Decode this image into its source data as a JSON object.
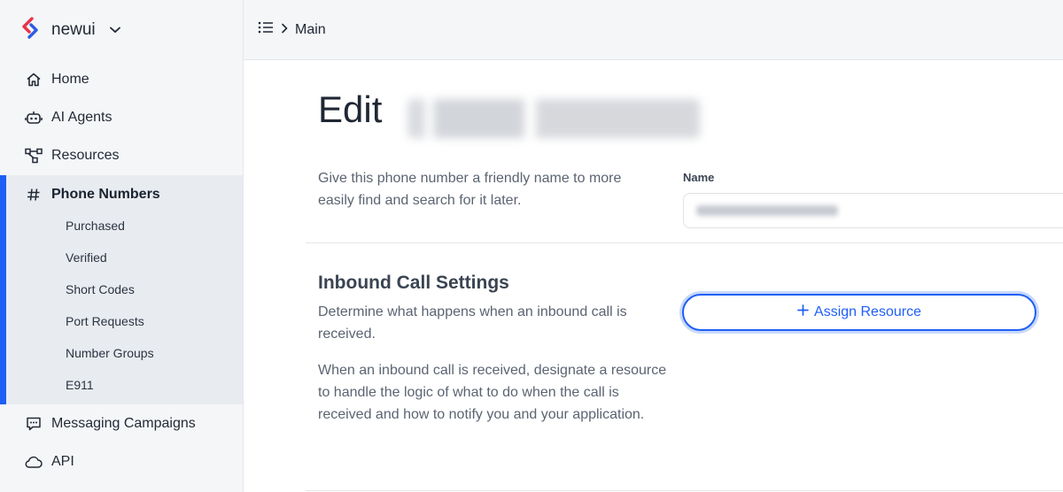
{
  "brand": {
    "name": "newui",
    "logo_icon": "brand-logo-icon",
    "caret_icon": "chevron-down-icon"
  },
  "sidebar": {
    "items": [
      {
        "label": "Home",
        "icon": "home-icon"
      },
      {
        "label": "AI Agents",
        "icon": "robot-icon"
      },
      {
        "label": "Resources",
        "icon": "resources-icon"
      },
      {
        "label": "Phone Numbers",
        "icon": "hash-icon",
        "active": true
      },
      {
        "label": "Messaging Campaigns",
        "icon": "chat-icon"
      },
      {
        "label": "API",
        "icon": "cloud-icon"
      }
    ],
    "sub_items": [
      "Purchased",
      "Verified",
      "Short Codes",
      "Port Requests",
      "Number Groups",
      "E911"
    ]
  },
  "topbar": {
    "menu_icon": "list-icon",
    "separator_icon": "chevron-right-icon",
    "crumb": "Main"
  },
  "main": {
    "title": "Edit",
    "name_section": {
      "description": "Give this phone number a friendly name to more easily find and search for it later.",
      "label": "Name"
    },
    "inbound": {
      "title": "Inbound Call Settings",
      "description": "Determine what happens when an inbound call is received.",
      "detail": "When an inbound call is received, designate a resource to handle the logic of what to do when the call is received and how to notify you and your application.",
      "button": "Assign Resource"
    }
  },
  "colors": {
    "accent": "#1e5ff5",
    "sidebar_bg": "#f5f6f8",
    "active_bg": "#e8ebef"
  }
}
